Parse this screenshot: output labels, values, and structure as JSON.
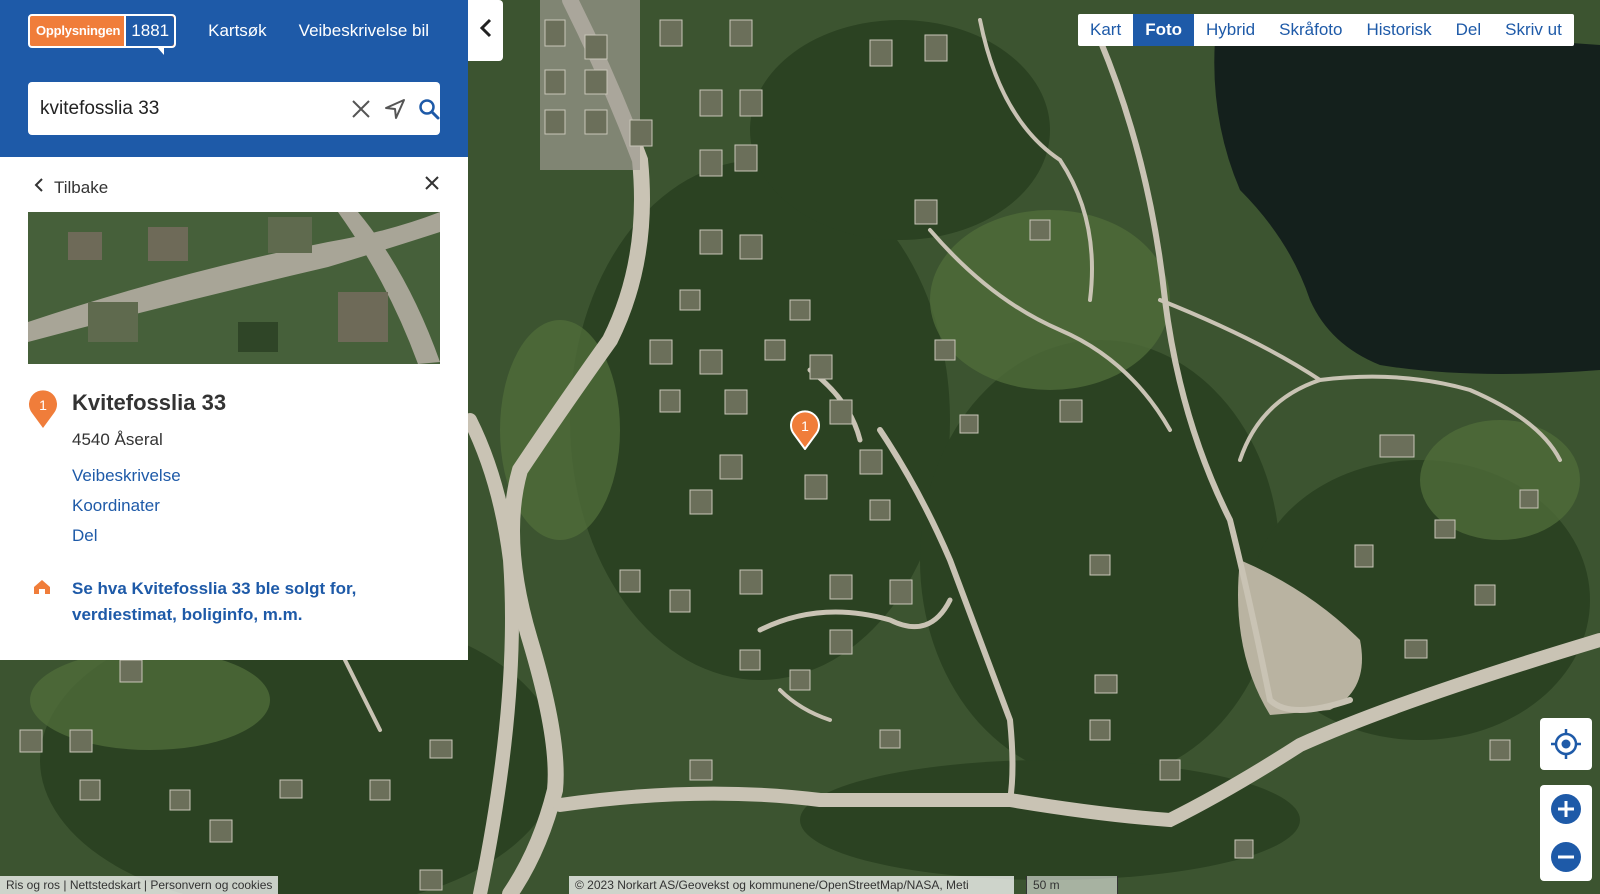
{
  "header": {
    "logo_text": "Opplysningen",
    "logo_number": "1881",
    "nav": [
      "Kartsøk",
      "Veibeskrivelse bil"
    ]
  },
  "search": {
    "value": "kvitefosslia 33",
    "clear_icon": "close-icon",
    "locate_icon": "location-arrow-icon",
    "search_icon": "search-icon"
  },
  "panel": {
    "back_label": "Tilbake",
    "close_icon": "close-icon",
    "result": {
      "pin_number": "1",
      "title": "Kvitefosslia 33",
      "address": "4540 Åseral",
      "links": [
        "Veibeskrivelse",
        "Koordinater",
        "Del"
      ],
      "promo_text": "Se hva Kvitefosslia 33 ble solgt for, verdiestimat, boliginfo, m.m.",
      "promo_icon": "house-icon"
    }
  },
  "map_tabs": {
    "items": [
      "Kart",
      "Foto",
      "Hybrid",
      "Skråfoto",
      "Historisk",
      "Del",
      "Skriv ut"
    ],
    "active": "Foto"
  },
  "map": {
    "marker_number": "1",
    "controls": [
      "my-location-icon",
      "zoom-in-icon",
      "zoom-out-icon"
    ]
  },
  "footer": {
    "links": [
      "Ris og ros",
      "Nettstedskart",
      "Personvern og cookies"
    ],
    "attribution": "© 2023 Norkart AS/Geovekst og kommunene/OpenStreetMap/NASA, Meti",
    "scale": "50 m"
  },
  "colors": {
    "brand_blue": "#1e5aa8",
    "brand_orange": "#f07d3a",
    "link_blue": "#1e5aa8"
  }
}
